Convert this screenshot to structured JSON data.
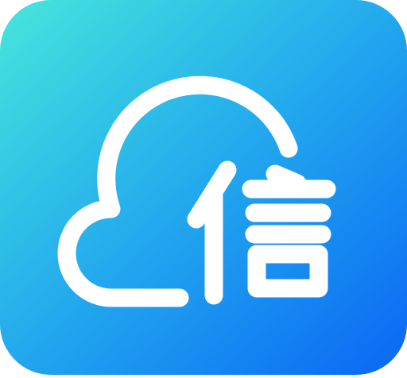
{
  "icon": {
    "name": "cloud-xin-app-icon",
    "logo_glyph": "信",
    "colors": {
      "gradient_start": "#46E6DC",
      "gradient_mid": "#22A8EE",
      "gradient_end": "#0A66F5",
      "foreground": "#FFFFFF"
    }
  }
}
